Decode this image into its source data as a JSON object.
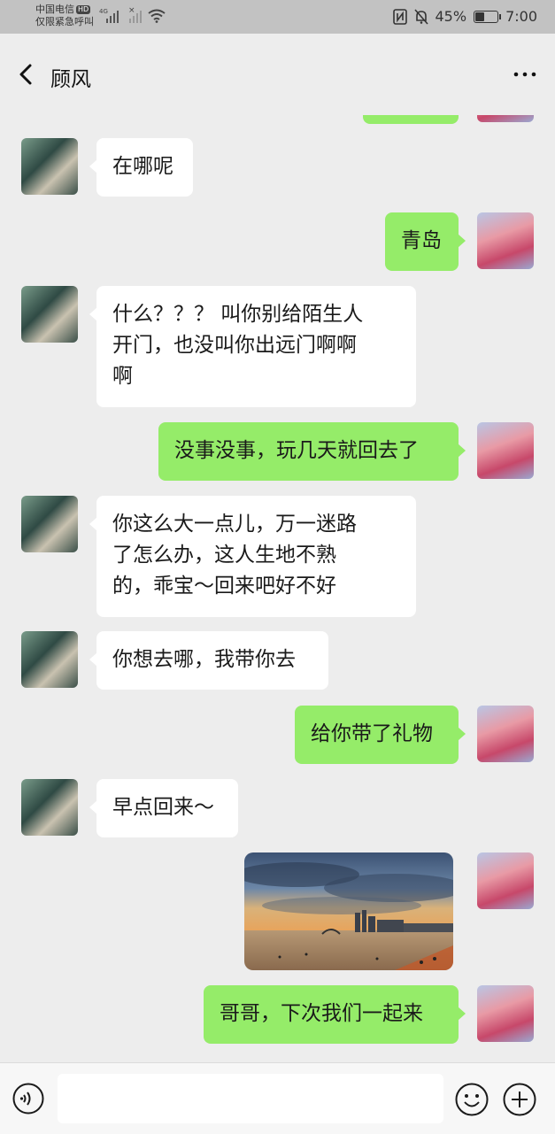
{
  "status_bar": {
    "carrier_line1": "中国电信",
    "hd_badge": "HD",
    "carrier_line2": "仅限紧急呼叫",
    "network": "4G",
    "nfc_icon": "nfc-icon",
    "mute_icon": "bell-off-icon",
    "battery_percent": "45%",
    "battery_level": 0.45,
    "time": "7:00"
  },
  "nav": {
    "back_icon": "chevron-left-icon",
    "title": "顾风",
    "more_icon": "more-dots-icon"
  },
  "messages": [
    {
      "side": "left",
      "text": "在哪呢"
    },
    {
      "side": "right",
      "text": "青岛"
    },
    {
      "side": "left",
      "text_lines": [
        "什么？？？ 叫你别给陌生人",
        "开门，也没叫你出远门啊啊",
        "啊"
      ]
    },
    {
      "side": "right",
      "text": "没事没事，玩几天就回去了"
    },
    {
      "side": "left",
      "text_lines": [
        "你这么大一点儿，万一迷路",
        "了怎么办，这人生地不熟",
        "的，乖宝～回来吧好不好"
      ]
    },
    {
      "side": "left",
      "text": "你想去哪，我带你去"
    },
    {
      "side": "right",
      "text": "给你带了礼物"
    },
    {
      "side": "left",
      "text": "早点回来～"
    },
    {
      "side": "right",
      "type": "image"
    },
    {
      "side": "right",
      "text": "哥哥，下次我们一起来"
    }
  ],
  "input_bar": {
    "voice_icon": "voice-icon",
    "input_value": "",
    "emoji_icon": "emoji-icon",
    "plus_icon": "plus-icon"
  },
  "colors": {
    "background": "#ededed",
    "bubble_right": "#95ec69",
    "bubble_left": "#ffffff",
    "status_bar": "#c2c2c2"
  }
}
